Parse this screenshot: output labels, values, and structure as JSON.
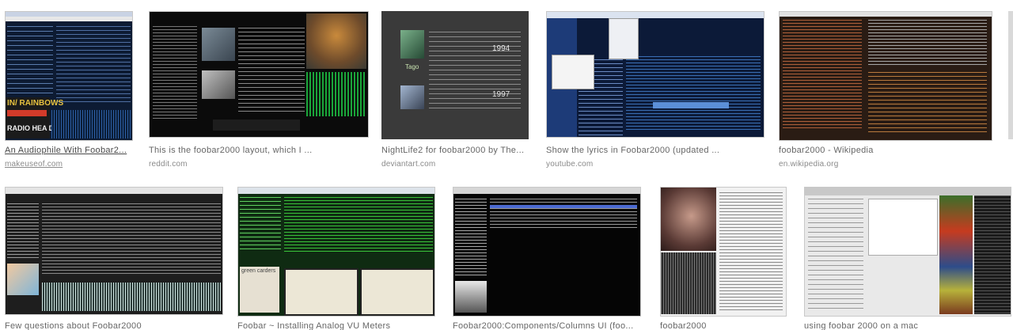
{
  "results": [
    {
      "title": "An Audiophile With Foobar2...",
      "source": "makeuseof.com",
      "title_link": true
    },
    {
      "title": "This is the foobar2000 layout, which I ...",
      "source": "reddit.com",
      "title_link": false
    },
    {
      "title": "NightLife2 for foobar2000 by The...",
      "source": "deviantart.com",
      "title_link": false
    },
    {
      "title": "Show the lyrics in Foobar2000 (updated ...",
      "source": "youtube.com",
      "title_link": false
    },
    {
      "title": "foobar2000 - Wikipedia",
      "source": "en.wikipedia.org",
      "title_link": false
    },
    {
      "title": "Few questions about Foobar2000",
      "source": "",
      "title_link": false
    },
    {
      "title": "Foobar ~ Installing Analog VU Meters",
      "source": "",
      "title_link": false
    },
    {
      "title": "Foobar2000:Components/Columns UI (foo...",
      "source": "",
      "title_link": false
    },
    {
      "title": "foobar2000",
      "source": "",
      "title_link": false
    },
    {
      "title": "using foobar 2000 on a mac",
      "source": "",
      "title_link": false
    }
  ],
  "thumb_text": {
    "radiohead": "IN/ RAINBOWS",
    "radiohead2": "RADIO HEA D",
    "nightlife_year1": "1994",
    "nightlife_year2": "1997",
    "nightlife_album": "Tago",
    "vu_label": "green carders"
  }
}
